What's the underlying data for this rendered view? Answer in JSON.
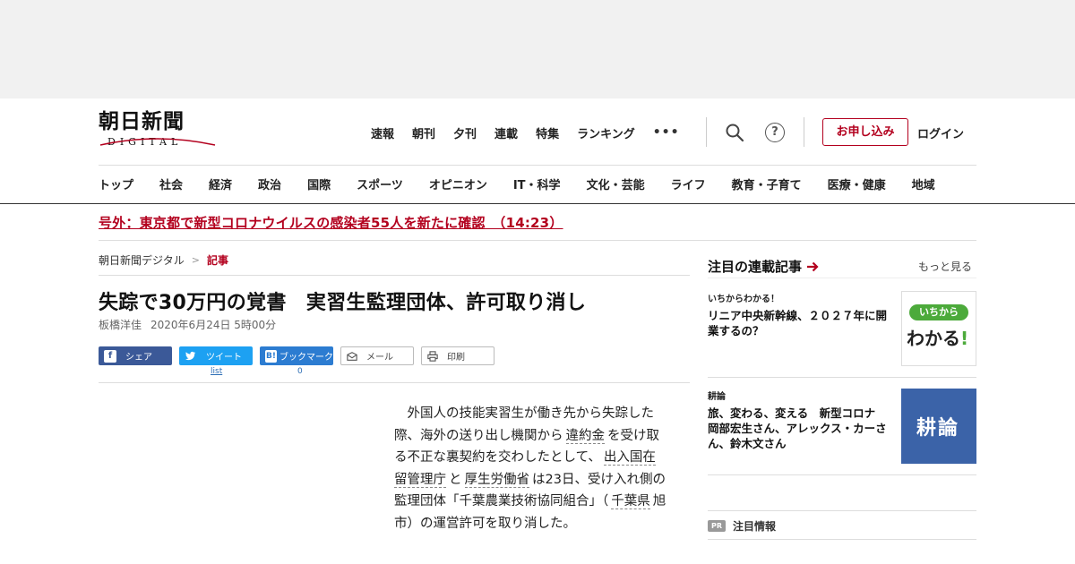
{
  "header": {
    "logo_main": "朝日新聞",
    "logo_sub": "DIGITAL",
    "nav": [
      "速報",
      "朝刊",
      "夕刊",
      "連載",
      "特集",
      "ランキング"
    ],
    "more": "•••",
    "help_glyph": "?",
    "subscribe": "お申し込み",
    "login": "ログイン"
  },
  "categories": [
    "トップ",
    "社会",
    "経済",
    "政治",
    "国際",
    "スポーツ",
    "オピニオン",
    "IT・科学",
    "文化・芸能",
    "ライフ",
    "教育・子育て",
    "医療・健康",
    "地域"
  ],
  "breaking": "号外：東京都で新型コロナウイルスの感染者55人を新たに確認　（14:23）",
  "breadcrumb": {
    "home": "朝日新聞デジタル",
    "sep": ">",
    "current": "記事"
  },
  "article": {
    "title": "失踪で30万円の覚書　実習生監理団体、許可取り消し",
    "author": "板橋洋佳",
    "date": "2020年6月24日 5時00分",
    "body": {
      "t1": "外国人の技能実習生が働き先から失踪した際、海外の送り出し機関から",
      "k1": "違約金",
      "t2": "を受け取る不正な裏契約を交わしたとして、",
      "k2": "出入国在留管理庁",
      "t3": "と",
      "k3": "厚生労働省",
      "t4": "は23日、受け入れ側の監理団体「千葉農業技術協同組合」（",
      "k4": "千葉県",
      "t5": "旭市）の運営許可を取り消した。"
    }
  },
  "share": {
    "facebook": "シェア",
    "twitter": "ツイート",
    "hatena": "ブックマーク",
    "hatena_glyph": "B!",
    "mail": "メール",
    "print": "印刷",
    "twitter_count": "list",
    "hatena_count": "0"
  },
  "sidebar": {
    "heading": "注目の連載記事",
    "more": "もっと見る",
    "cards": [
      {
        "kicker": "いちからわかる！",
        "title": "リニア中央新幹線、２０２７年に開業するの？",
        "thumb_pill": "いちから",
        "thumb_big": "わかる",
        "thumb_bang": "!"
      },
      {
        "kicker": "耕論",
        "title": "旅、変わる、変える　新型コロナ　岡部宏生さん、アレックス・カーさん、鈴木文さん",
        "thumb_text": "耕論"
      }
    ],
    "pr_badge": "PR",
    "pr_label": "注目情報"
  },
  "colors": {
    "accent": "#b3001e",
    "facebook": "#3b5998",
    "twitter": "#1da1f2",
    "hatena": "#2c7cd1",
    "wakaru_green": "#4caa3b",
    "koron_blue": "#3b63a8"
  }
}
